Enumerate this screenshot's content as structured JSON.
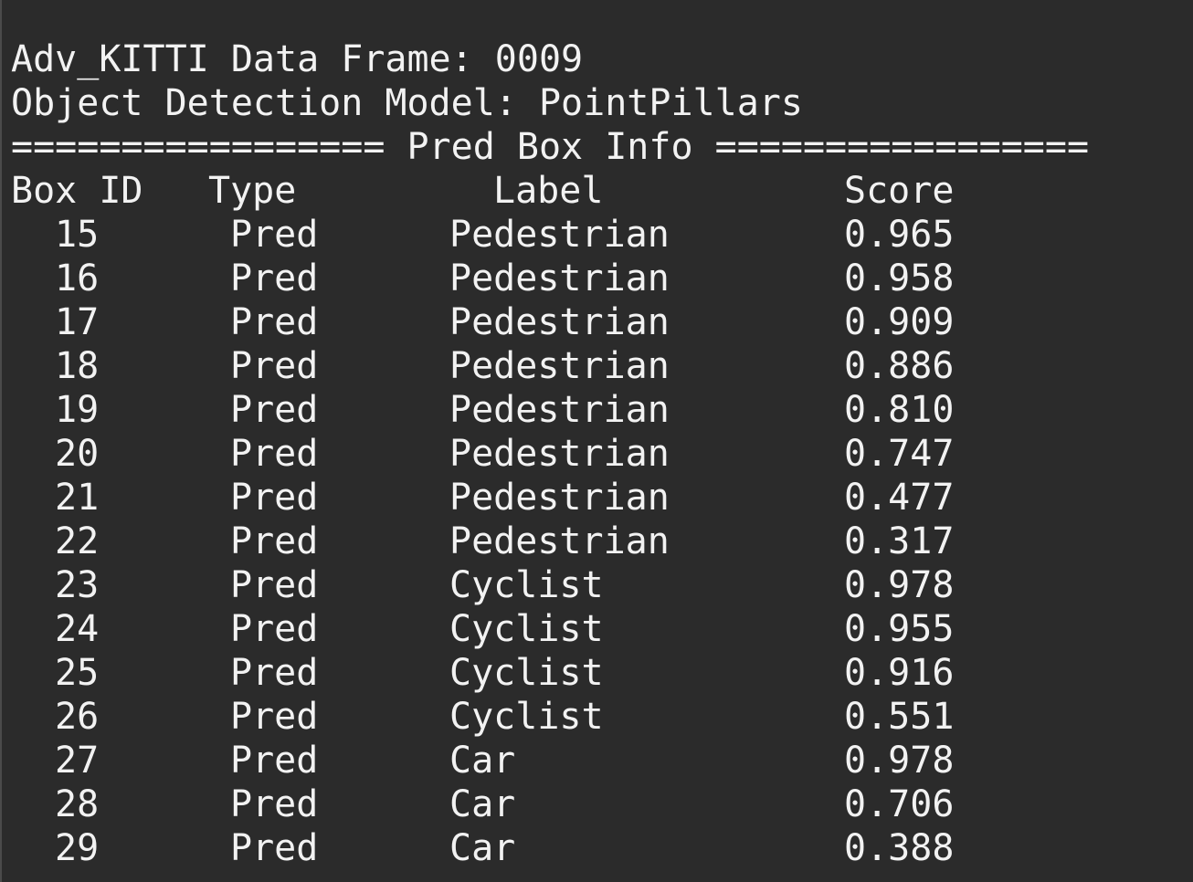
{
  "header": {
    "frame_line": "Adv_KITTI Data Frame: 0009",
    "model_line": "Object Detection Model: PointPillars",
    "section_line": "================= Pred Box Info ================="
  },
  "table": {
    "columns": [
      "Box ID",
      "Type",
      "Label",
      "Score"
    ],
    "rows": [
      {
        "id": "15",
        "type": "Pred",
        "label": "Pedestrian",
        "score": "0.965"
      },
      {
        "id": "16",
        "type": "Pred",
        "label": "Pedestrian",
        "score": "0.958"
      },
      {
        "id": "17",
        "type": "Pred",
        "label": "Pedestrian",
        "score": "0.909"
      },
      {
        "id": "18",
        "type": "Pred",
        "label": "Pedestrian",
        "score": "0.886"
      },
      {
        "id": "19",
        "type": "Pred",
        "label": "Pedestrian",
        "score": "0.810"
      },
      {
        "id": "20",
        "type": "Pred",
        "label": "Pedestrian",
        "score": "0.747"
      },
      {
        "id": "21",
        "type": "Pred",
        "label": "Pedestrian",
        "score": "0.477"
      },
      {
        "id": "22",
        "type": "Pred",
        "label": "Pedestrian",
        "score": "0.317"
      },
      {
        "id": "23",
        "type": "Pred",
        "label": "Cyclist",
        "score": "0.978"
      },
      {
        "id": "24",
        "type": "Pred",
        "label": "Cyclist",
        "score": "0.955"
      },
      {
        "id": "25",
        "type": "Pred",
        "label": "Cyclist",
        "score": "0.916"
      },
      {
        "id": "26",
        "type": "Pred",
        "label": "Cyclist",
        "score": "0.551"
      },
      {
        "id": "27",
        "type": "Pred",
        "label": "Car",
        "score": "0.978"
      },
      {
        "id": "28",
        "type": "Pred",
        "label": "Car",
        "score": "0.706"
      },
      {
        "id": "29",
        "type": "Pred",
        "label": "Car",
        "score": "0.388"
      }
    ]
  },
  "colors": {
    "background": "#2b2b2b",
    "text": "#f2f2f2"
  }
}
